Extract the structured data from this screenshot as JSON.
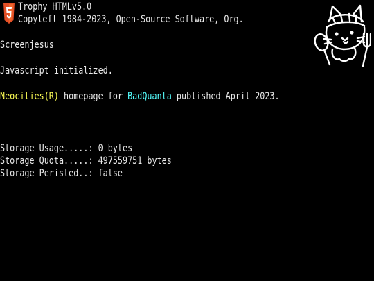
{
  "boot": {
    "product": "Trophy HTMLv5.0",
    "copyright": "Copyleft 1984-2023, Open-Source Software, Org.",
    "name": "Screenjesus",
    "status": "Javascript initialized."
  },
  "publish": {
    "brand": "Neocities(R)",
    "middle": " homepage for ",
    "user": "BadQuanta",
    "tail": " published April 2023."
  },
  "storage": {
    "usage_label": "Storage Usage.....: ",
    "usage_value": "0 bytes",
    "quota_label": "Storage Quota.....: ",
    "quota_value": "497559751 bytes",
    "persisted_label": "Storage Peristed..: ",
    "persisted_value": "false"
  },
  "icons": {
    "logo": "html5-shield-logo",
    "mascot": "cat-chef-mascot-icon"
  },
  "colors": {
    "background": "#000000",
    "text": "#e8e8e8",
    "highlight_yellow": "#ffff55",
    "highlight_cyan": "#55ffff",
    "logo_orange": "#e34f26"
  }
}
